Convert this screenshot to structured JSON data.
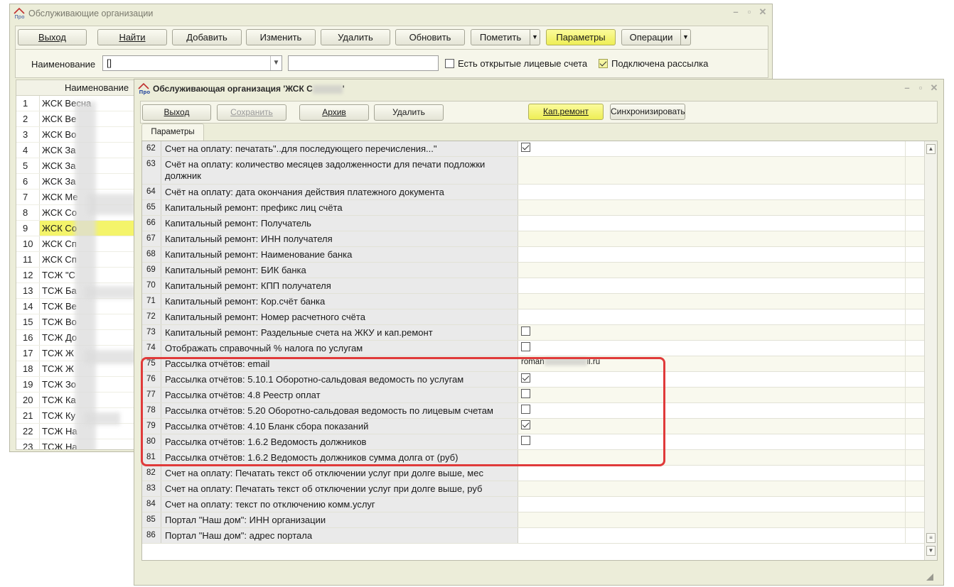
{
  "back_window": {
    "title": "Обслуживающие организации",
    "toolbar": {
      "exit": "Выход",
      "find": "Найти",
      "add": "Добавить",
      "edit": "Изменить",
      "delete": "Удалить",
      "refresh": "Обновить",
      "mark": "Пометить",
      "params": "Параметры",
      "operations": "Операции"
    },
    "filter": {
      "label": "Наименование",
      "combo_value": "[]",
      "text_value": "",
      "open_accounts_label": "Есть открытые лицевые счета",
      "open_accounts_checked": false,
      "mailing_label": "Подключена рассылка",
      "mailing_checked": true
    },
    "list": {
      "header": "Наименование",
      "rows": [
        {
          "n": "1",
          "text": "ЖСК Весна"
        },
        {
          "n": "2",
          "text": "ЖСК Ве"
        },
        {
          "n": "3",
          "text": "ЖСК Во"
        },
        {
          "n": "4",
          "text": "ЖСК За"
        },
        {
          "n": "5",
          "text": "ЖСК За"
        },
        {
          "n": "6",
          "text": "ЖСК За"
        },
        {
          "n": "7",
          "text": "ЖСК Ме"
        },
        {
          "n": "8",
          "text": "ЖСК Со"
        },
        {
          "n": "9",
          "text": "ЖСК Со",
          "selected": true
        },
        {
          "n": "10",
          "text": "ЖСК Сп"
        },
        {
          "n": "11",
          "text": "ЖСК Сп"
        },
        {
          "n": "12",
          "text": "ТСЖ \"С"
        },
        {
          "n": "13",
          "text": "ТСЖ Ба"
        },
        {
          "n": "14",
          "text": "ТСЖ Ве"
        },
        {
          "n": "15",
          "text": "ТСЖ Во"
        },
        {
          "n": "16",
          "text": "ТСЖ До"
        },
        {
          "n": "17",
          "text": "ТСЖ Ж"
        },
        {
          "n": "18",
          "text": "ТСЖ Ж"
        },
        {
          "n": "19",
          "text": "ТСЖ Зо"
        },
        {
          "n": "20",
          "text": "ТСЖ Ка"
        },
        {
          "n": "21",
          "text": "ТСЖ Ку"
        },
        {
          "n": "22",
          "text": "ТСЖ На"
        },
        {
          "n": "23",
          "text": "ТСЖ На"
        }
      ]
    }
  },
  "front_window": {
    "title": "Обслуживающая организация 'ЖСК С",
    "title_end": "'",
    "toolbar": {
      "exit": "Выход",
      "save": "Сохранить",
      "archive": "Архив",
      "delete": "Удалить",
      "cap_repair": "Кап.ремонт",
      "sync": "Синхронизировать"
    },
    "tab": "Параметры",
    "rows": [
      {
        "n": "62",
        "name": "Счет на оплату: печатать\"..для последующего перечисления...\"",
        "type": "check",
        "checked": true
      },
      {
        "n": "63",
        "name": "Счёт на оплату: количество месяцев задолженности для печати подложки должник",
        "type": "text",
        "value": "",
        "tall": true
      },
      {
        "n": "64",
        "name": "Счёт на оплату: дата окончания действия платежного документа",
        "type": "text",
        "value": ""
      },
      {
        "n": "65",
        "name": "Капитальный ремонт: префикс лиц счёта",
        "type": "text",
        "value": ""
      },
      {
        "n": "66",
        "name": "Капитальный ремонт: Получатель",
        "type": "text",
        "value": ""
      },
      {
        "n": "67",
        "name": "Капитальный ремонт: ИНН получателя",
        "type": "text",
        "value": ""
      },
      {
        "n": "68",
        "name": "Капитальный ремонт: Наименование банка",
        "type": "text",
        "value": ""
      },
      {
        "n": "69",
        "name": "Капитальный ремонт: БИК банка",
        "type": "text",
        "value": ""
      },
      {
        "n": "70",
        "name": "Капитальный ремонт: КПП получателя",
        "type": "text",
        "value": ""
      },
      {
        "n": "71",
        "name": "Капитальный ремонт: Кор.счёт банка",
        "type": "text",
        "value": ""
      },
      {
        "n": "72",
        "name": "Капитальный ремонт: Номер расчетного счёта",
        "type": "text",
        "value": ""
      },
      {
        "n": "73",
        "name": "Капитальный ремонт: Раздельные счета на ЖКУ и кап.ремонт",
        "type": "check",
        "checked": false
      },
      {
        "n": "74",
        "name": "Отображать справочный % налога по услугам",
        "type": "check",
        "checked": false
      },
      {
        "n": "75",
        "name": "Рассылка отчётов: email",
        "type": "text",
        "value": "roman",
        "value_end": "il.ru"
      },
      {
        "n": "76",
        "name": "Рассылка отчётов: 5.10.1 Оборотно-сальдовая ведомость по услугам",
        "type": "check",
        "checked": true
      },
      {
        "n": "77",
        "name": "Рассылка отчётов: 4.8 Реестр оплат",
        "type": "check",
        "checked": false
      },
      {
        "n": "78",
        "name": "Рассылка отчётов: 5.20 Оборотно-сальдовая ведомость по лицевым счетам",
        "type": "check",
        "checked": false
      },
      {
        "n": "79",
        "name": "Рассылка отчётов: 4.10 Бланк сбора показаний",
        "type": "check",
        "checked": true
      },
      {
        "n": "80",
        "name": "Рассылка отчётов: 1.6.2 Ведомость должников",
        "type": "check",
        "checked": false
      },
      {
        "n": "81",
        "name": "Рассылка отчётов: 1.6.2 Ведомость должников сумма долга от (руб)",
        "type": "text",
        "value": ""
      },
      {
        "n": "82",
        "name": "Счет на оплату: Печатать текст об отключении услуг при долге выше, мес",
        "type": "text",
        "value": ""
      },
      {
        "n": "83",
        "name": "Счет на оплату: Печатать текст об отключении услуг при долге выше, руб",
        "type": "text",
        "value": ""
      },
      {
        "n": "84",
        "name": "Счет на оплату: текст по отключению комм.услуг",
        "type": "text",
        "value": ""
      },
      {
        "n": "85",
        "name": "Портал \"Наш дом\": ИНН организации",
        "type": "text",
        "value": ""
      },
      {
        "n": "86",
        "name": "Портал \"Наш дом\": адрес портала",
        "type": "text",
        "value": ""
      }
    ]
  },
  "colors": {
    "window_bg": "#ecedd9",
    "highlight_button": "#f4f46a",
    "annotation_box": "#e03a3a"
  }
}
